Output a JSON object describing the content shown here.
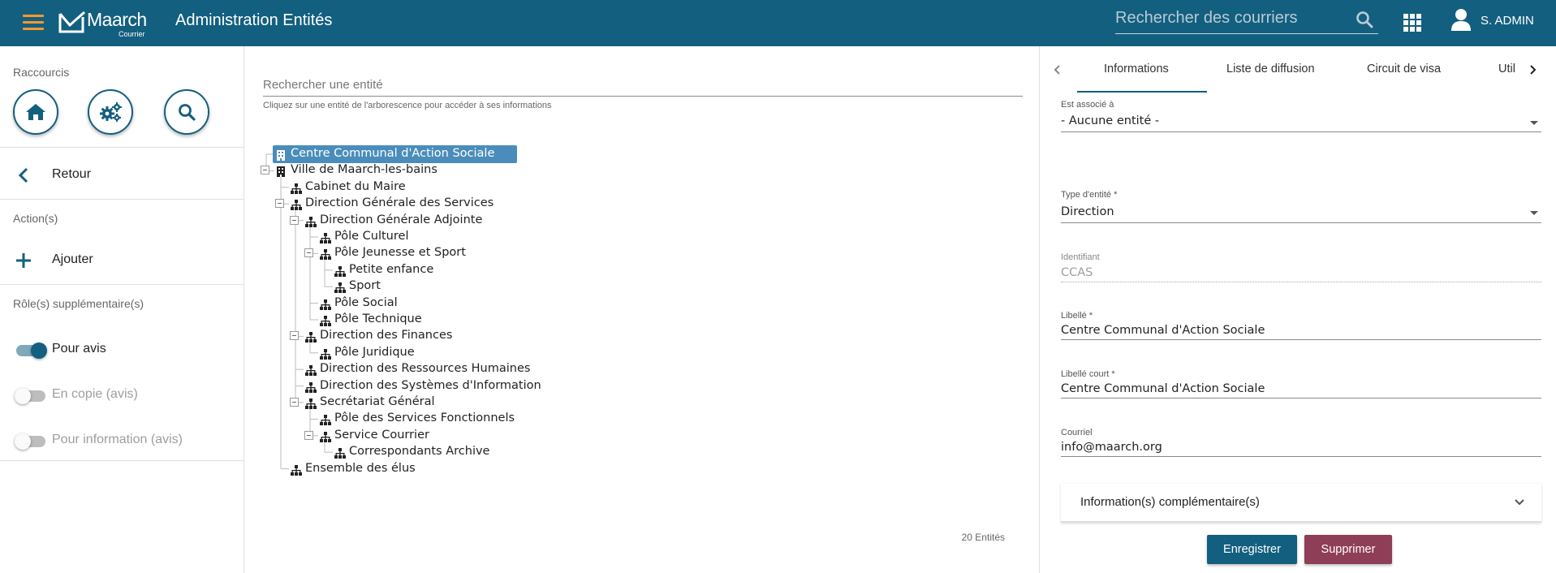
{
  "header": {
    "logo_name": "Maarch",
    "logo_sub": "Courrier",
    "title": "Administration Entités",
    "search_placeholder": "Rechercher des courriers",
    "user_name": "S. ADMIN",
    "accent_color": "#135f7f",
    "menu_color": "#f99830"
  },
  "sidebar": {
    "shortcuts_label": "Raccourcis",
    "shortcuts": [
      {
        "icon": "home-icon"
      },
      {
        "icon": "gears-icon"
      },
      {
        "icon": "search-icon"
      }
    ],
    "back_label": "Retour",
    "actions_label": "Action(s)",
    "add_label": "Ajouter",
    "roles_label": "Rôle(s) supplémentaire(s)",
    "roles": [
      {
        "label": "Pour avis",
        "enabled": true
      },
      {
        "label": "En copie (avis)",
        "enabled": false
      },
      {
        "label": "Pour information (avis)",
        "enabled": false
      }
    ]
  },
  "tree": {
    "search_placeholder": "Rechercher une entité",
    "hint": "Cliquez sur une entité de l'arborescence pour accéder à ses informations",
    "count_label": "20 Entités",
    "nodes": [
      {
        "label": "Centre Communal d'Action Sociale",
        "level": 0,
        "icon": "building-icon",
        "selected": true
      },
      {
        "label": "Ville de Maarch-les-bains",
        "level": 0,
        "icon": "building-icon",
        "expanded": true
      },
      {
        "label": "Cabinet du Maire",
        "level": 1,
        "icon": "sitemap-icon"
      },
      {
        "label": "Direction Générale des Services",
        "level": 1,
        "icon": "sitemap-icon",
        "expanded": true
      },
      {
        "label": "Direction Générale Adjointe",
        "level": 2,
        "icon": "sitemap-icon",
        "expanded": true
      },
      {
        "label": "Pôle Culturel",
        "level": 3,
        "icon": "sitemap-icon"
      },
      {
        "label": "Pôle Jeunesse et Sport",
        "level": 3,
        "icon": "sitemap-icon",
        "expanded": true
      },
      {
        "label": "Petite enfance",
        "level": 4,
        "icon": "sitemap-icon"
      },
      {
        "label": "Sport",
        "level": 4,
        "icon": "sitemap-icon"
      },
      {
        "label": "Pôle Social",
        "level": 3,
        "icon": "sitemap-icon"
      },
      {
        "label": "Pôle Technique",
        "level": 3,
        "icon": "sitemap-icon"
      },
      {
        "label": "Direction des Finances",
        "level": 2,
        "icon": "sitemap-icon",
        "expanded": true
      },
      {
        "label": "Pôle Juridique",
        "level": 3,
        "icon": "sitemap-icon"
      },
      {
        "label": "Direction des Ressources Humaines",
        "level": 2,
        "icon": "sitemap-icon"
      },
      {
        "label": "Direction des Systèmes d'Information",
        "level": 2,
        "icon": "sitemap-icon"
      },
      {
        "label": "Secrétariat Général",
        "level": 2,
        "icon": "sitemap-icon",
        "expanded": true
      },
      {
        "label": "Pôle des Services Fonctionnels",
        "level": 3,
        "icon": "sitemap-icon"
      },
      {
        "label": "Service Courrier",
        "level": 3,
        "icon": "sitemap-icon",
        "expanded": true
      },
      {
        "label": "Correspondants Archive",
        "level": 4,
        "icon": "sitemap-icon"
      },
      {
        "label": "Ensemble des élus",
        "level": 1,
        "icon": "sitemap-icon"
      }
    ]
  },
  "panel": {
    "tabs": [
      "Informations",
      "Liste de diffusion",
      "Circuit de visa",
      "Utilis"
    ],
    "active_tab": "Informations",
    "fields": {
      "associated_label": "Est associé à",
      "associated_value": "- Aucune entité -",
      "type_label": "Type d'entité *",
      "type_value": "Direction",
      "id_label": "Identifiant",
      "id_value": "CCAS",
      "label_label": "Libellé *",
      "label_value": "Centre Communal d'Action Sociale",
      "short_label": "Libellé court *",
      "short_value": "Centre Communal d'Action Sociale",
      "email_label": "Courriel",
      "email_value": "info@maarch.org"
    },
    "more_info_label": "Information(s) complémentaire(s)",
    "save_label": "Enregistrer",
    "delete_label": "Supprimer",
    "save_color": "#135f7f",
    "delete_color": "#8e3e57"
  }
}
